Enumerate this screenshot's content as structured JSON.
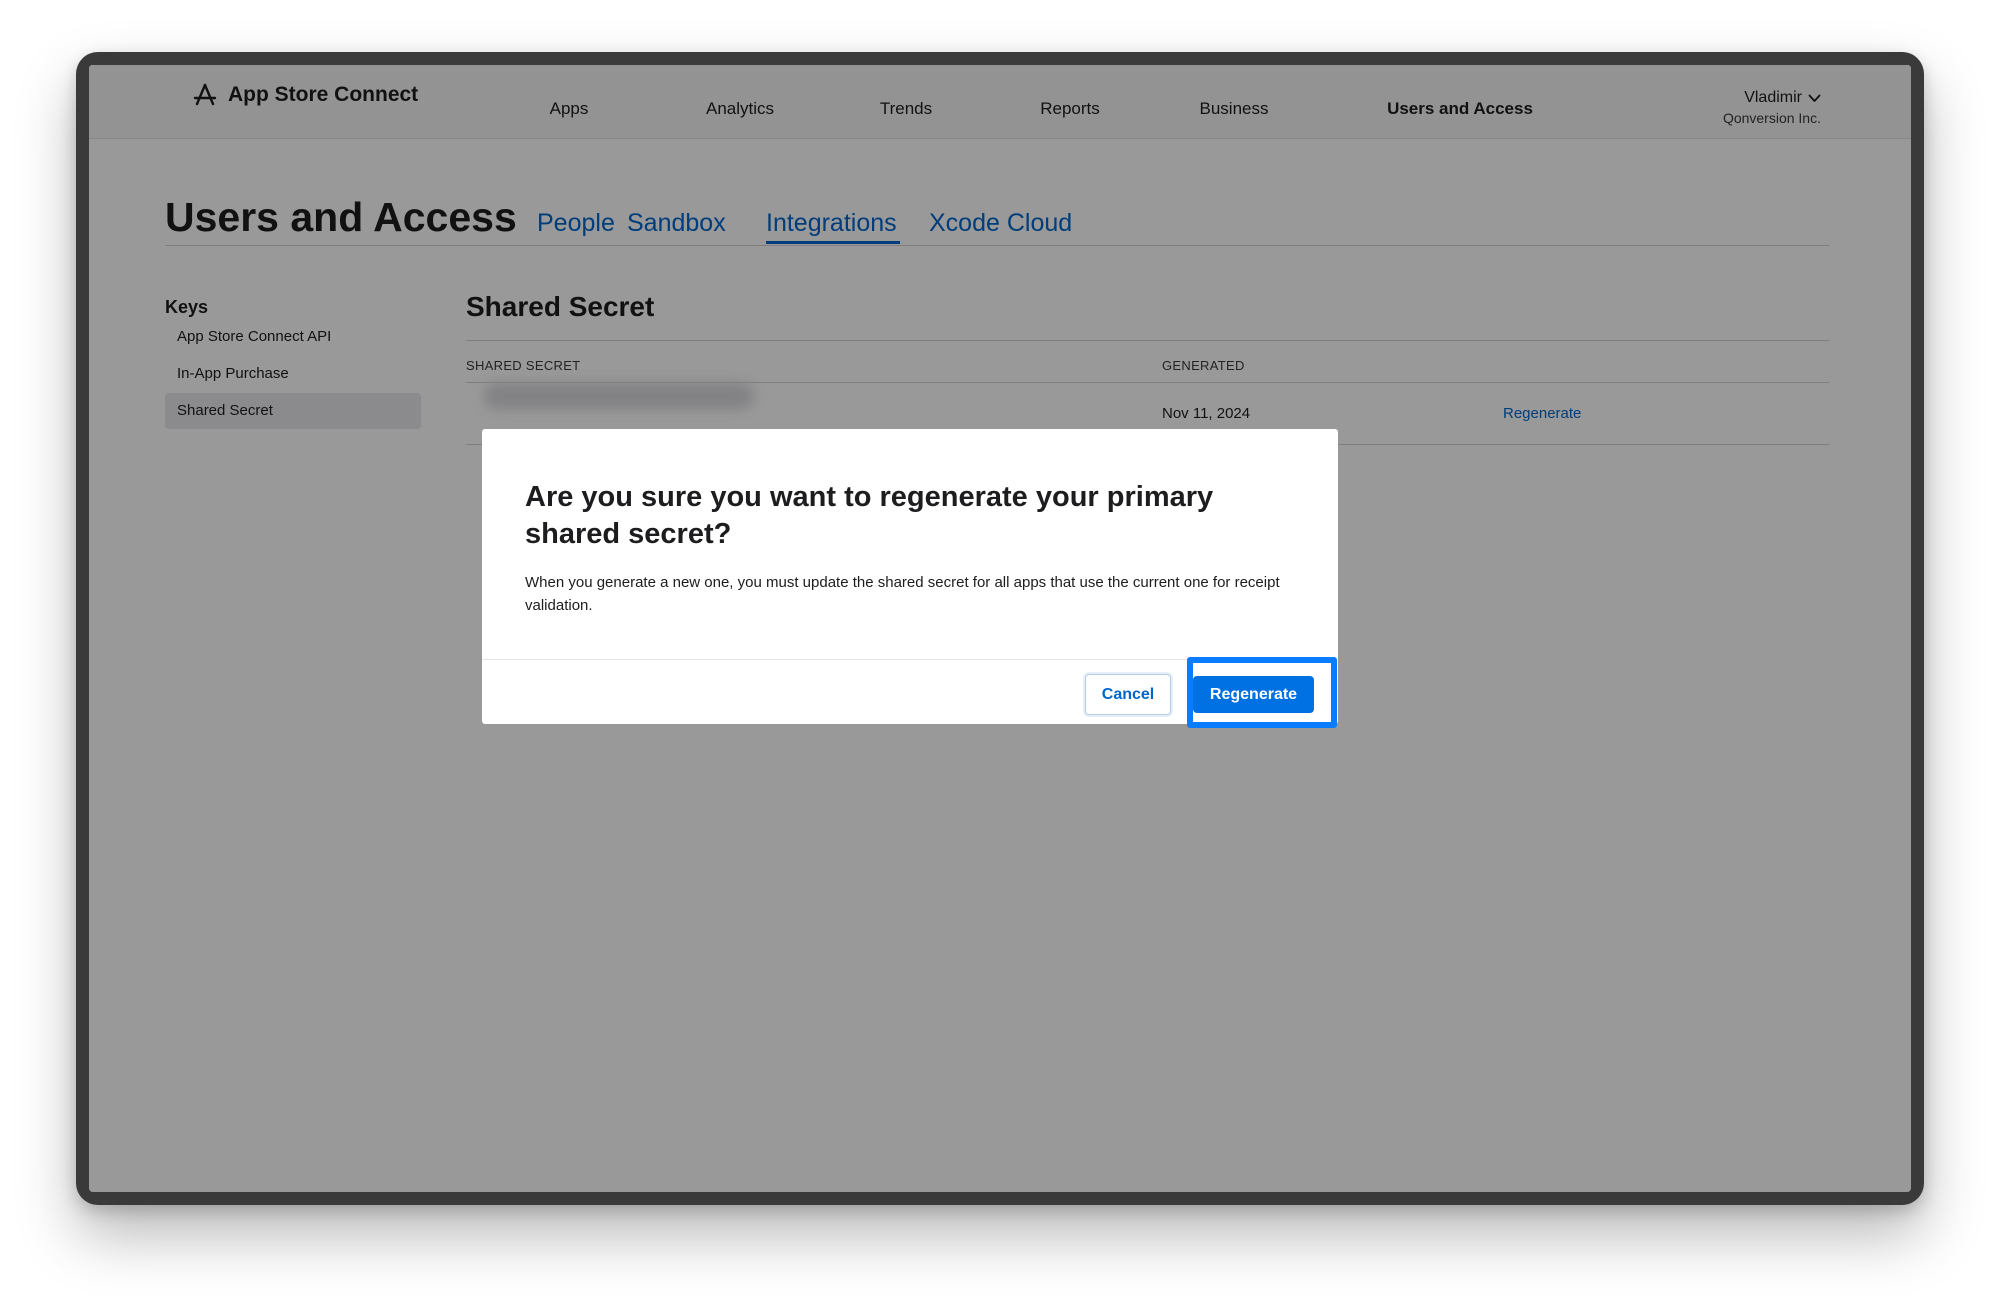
{
  "nav": {
    "brand": "App Store Connect",
    "brand_icon": "app-store-icon",
    "items": [
      {
        "label": "Apps"
      },
      {
        "label": "Analytics"
      },
      {
        "label": "Trends"
      },
      {
        "label": "Reports"
      },
      {
        "label": "Business"
      },
      {
        "label": "Users and Access"
      }
    ],
    "active": "Users and Access",
    "user": {
      "name": "Vladimir",
      "org": "Qonversion Inc."
    }
  },
  "page": {
    "title": "Users and Access",
    "tabs": [
      {
        "label": "People"
      },
      {
        "label": "Sandbox"
      },
      {
        "label": "Integrations"
      },
      {
        "label": "Xcode Cloud"
      }
    ],
    "active_tab": "Integrations"
  },
  "sidebar": {
    "heading": "Keys",
    "items": [
      {
        "label": "App Store Connect API"
      },
      {
        "label": "In-App Purchase"
      },
      {
        "label": "Shared Secret"
      }
    ],
    "selected": "Shared Secret"
  },
  "main": {
    "section_title": "Shared Secret",
    "columns": [
      "SHARED SECRET",
      "GENERATED"
    ],
    "row": {
      "generated": "Nov 11, 2024",
      "action": "Regenerate"
    }
  },
  "dialog": {
    "title": "Are you sure you want to regenerate your primary shared secret?",
    "body": "When you generate a new one, you must update the shared secret for all apps that use the current one for receipt validation.",
    "cancel_label": "Cancel",
    "confirm_label": "Regenerate"
  },
  "colors": {
    "accent": "#0066cc",
    "primary_button": "#0071e3",
    "highlight": "#0a7cff"
  }
}
